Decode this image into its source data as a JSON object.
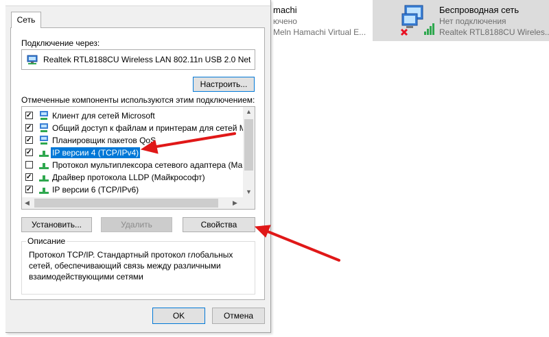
{
  "background_window": {
    "left_item": {
      "title": "machi",
      "status": "ючено",
      "adapter": "Meln Hamachi Virtual E..."
    },
    "right_item": {
      "title": "Беспроводная сеть",
      "status": "Нет подключения",
      "adapter": "Realtek RTL8188CU Wireles..."
    }
  },
  "dialog": {
    "tab_label": "Сеть",
    "connect_via_label": "Подключение через:",
    "adapter_name": "Realtek RTL8188CU Wireless LAN 802.11n USB 2.0 Net",
    "configure_button": "Настроить...",
    "components_label": "Отмеченные компоненты используются этим подключением:",
    "components": [
      {
        "label": "Клиент для сетей Microsoft",
        "checked": true,
        "icon": "network-client-icon"
      },
      {
        "label": "Общий доступ к файлам и принтерам для сетей Mi",
        "checked": true,
        "icon": "file-sharing-icon"
      },
      {
        "label": "Планировщик пакетов QoS",
        "checked": true,
        "icon": "qos-scheduler-icon"
      },
      {
        "label": "IP версии 4 (TCP/IPv4)",
        "checked": true,
        "icon": "protocol-icon",
        "selected": true
      },
      {
        "label": "Протокол мультиплексора сетевого адаптера (Май",
        "checked": false,
        "icon": "protocol-icon"
      },
      {
        "label": "Драйвер протокола LLDP (Майкрософт)",
        "checked": true,
        "icon": "protocol-icon"
      },
      {
        "label": "IP версии 6 (TCP/IPv6)",
        "checked": true,
        "icon": "protocol-icon"
      }
    ],
    "install_button": "Установить...",
    "remove_button": "Удалить",
    "properties_button": "Свойства",
    "description_title": "Описание",
    "description_text": "Протокол TCP/IP. Стандартный протокол глобальных сетей, обеспечивающий связь между различными взаимодействующими сетями",
    "ok_button": "OK",
    "cancel_button": "Отмена"
  },
  "colors": {
    "selection": "#0078d7",
    "annotation_arrow": "#e01818",
    "dialog_bg": "#f0f0f0"
  }
}
